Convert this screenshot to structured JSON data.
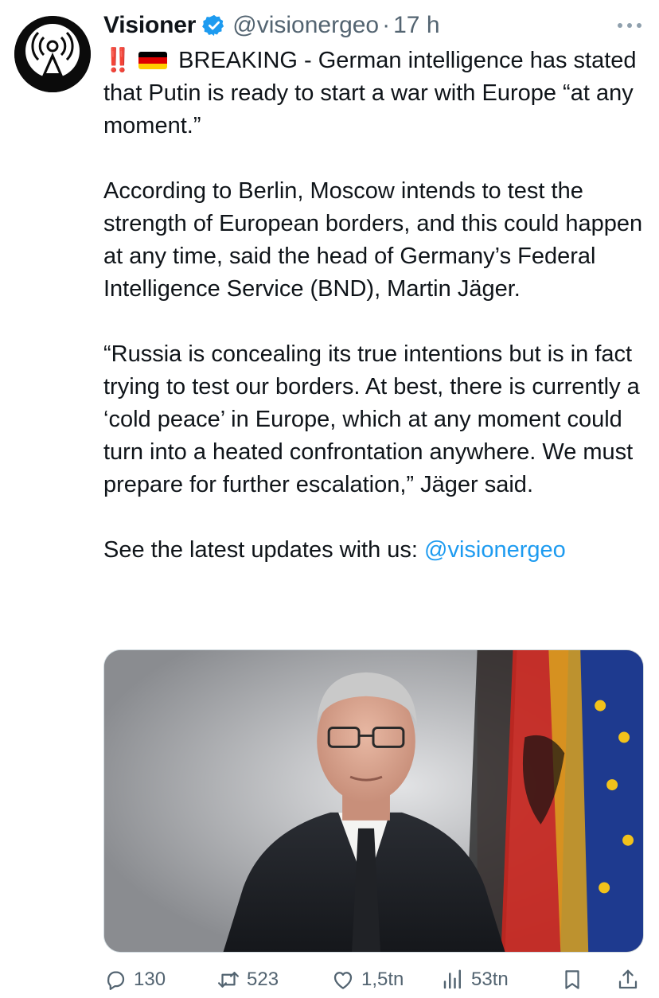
{
  "tweet": {
    "author_name": "Visioner",
    "handle": "@visionergeo",
    "separator": "·",
    "time": "17 h",
    "breaking_marks": "‼️",
    "headline": "BREAKING - German intelligence has stated that Putin is ready to start a war with Europe “at any moment.”",
    "paragraph_2": "According to Berlin, Moscow intends to test the strength of European borders, and this could happen at any time, said the head of Germany’s Federal Intelligence Service (BND), Martin Jäger.",
    "paragraph_3": "“Russia is concealing its true intentions but is in fact trying to test our borders. At best, there is currently a ‘cold peace’ in Europe, which at any moment could turn into a heated confrontation anywhere. We must prepare for further escalation,” Jäger said.",
    "cta_text": "See the latest updates with us: ",
    "cta_mention": "@visionergeo"
  },
  "metrics": {
    "replies": "130",
    "reposts": "523",
    "likes": "1,5tn",
    "views": "53tn"
  },
  "icons": {
    "avatar": "broadcast-antenna-icon",
    "verified": "verified-badge-icon",
    "more": "more-options-icon",
    "flag": "germany-flag-icon",
    "reply": "reply-icon",
    "repost": "repost-icon",
    "like": "like-icon",
    "views": "views-icon",
    "bookmark": "bookmark-icon",
    "share": "share-icon"
  },
  "colors": {
    "text": "#0f1419",
    "secondary": "#536471",
    "link": "#1d9bf0",
    "verified": "#1d9bf0",
    "alert": "#e0261c"
  }
}
